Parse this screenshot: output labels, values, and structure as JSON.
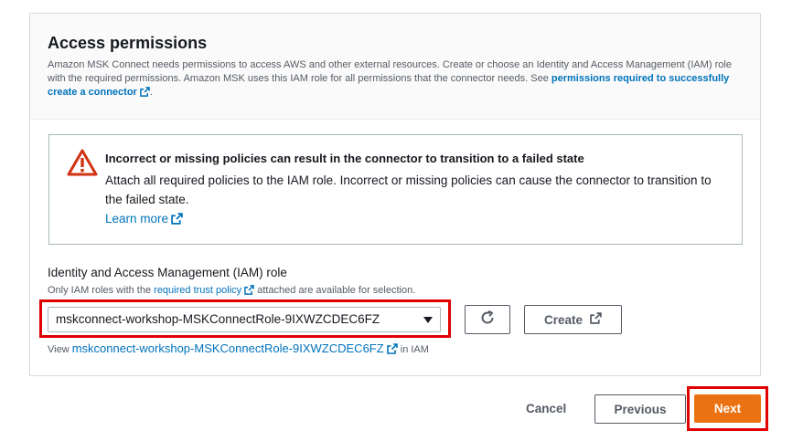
{
  "panel": {
    "title": "Access permissions",
    "description_pre": "Amazon MSK Connect needs permissions to access AWS and other external resources. Create or choose an Identity and Access Management (IAM) role with the required permissions. Amazon MSK uses this IAM role for all permissions that the connector needs. See ",
    "description_link": "permissions required to successfully create a connector",
    "description_post": "."
  },
  "alert": {
    "title": "Incorrect or missing policies can result in the connector to transition to a failed state",
    "body": "Attach all required policies to the IAM role. Incorrect or missing policies can cause the connector to transition to the failed state.",
    "learn_more": "Learn more",
    "icon": "warning-triangle-icon"
  },
  "iam_role": {
    "label": "Identity and Access Management (IAM) role",
    "desc_pre": "Only IAM roles with the ",
    "desc_link": "required trust policy",
    "desc_post": " attached are available for selection.",
    "selected": "mskconnect-workshop-MSKConnectRole-9IXWZCDEC6FZ",
    "create_label": "Create",
    "view_pre": "View ",
    "view_link": "mskconnect-workshop-MSKConnectRole-9IXWZCDEC6FZ",
    "view_post": " in IAM"
  },
  "footer": {
    "cancel": "Cancel",
    "previous": "Previous",
    "next": "Next"
  },
  "colors": {
    "link": "#0073bb",
    "primary": "#ec7211",
    "warning": "#d13212",
    "highlight": "#e00000"
  }
}
